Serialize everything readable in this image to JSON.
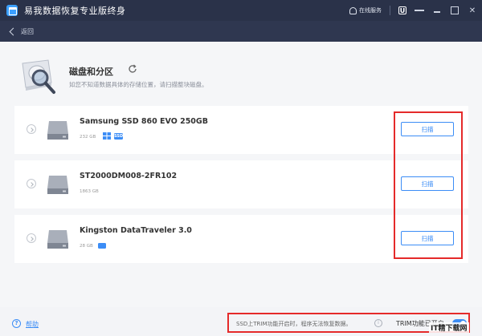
{
  "window": {
    "title": "易我数据恢复专业版终身",
    "online_service": "在线服务",
    "account_icon_text": "U"
  },
  "nav": {
    "back_label": "返回"
  },
  "header": {
    "title": "磁盘和分区",
    "subtitle": "如您不知道数据具体的存储位置，请扫描整块磁盘。"
  },
  "drives": [
    {
      "name": "Samsung SSD 860 EVO 250GB",
      "size": "232 GB",
      "badges": [
        "windows-icon",
        "ssd-badge"
      ],
      "badge_text": "SSD",
      "scan_label": "扫描"
    },
    {
      "name": "ST2000DM008-2FR102",
      "size": "1863 GB",
      "scan_label": "扫描"
    },
    {
      "name": "Kingston DataTraveler 3.0",
      "size": "28 GB",
      "badges": [
        "usb-badge"
      ],
      "scan_label": "扫描"
    }
  ],
  "footer": {
    "help_label": "帮助",
    "trim_warning": "SSD上TRIM功能开启时，程序无法恢复数据。",
    "trim_label": "TRIM功能已开启",
    "trim_enabled": true
  },
  "watermark": "IT精下载网",
  "colors": {
    "accent": "#3c8df6",
    "titlebar": "#2a3249",
    "highlight": "#e52a2a"
  }
}
